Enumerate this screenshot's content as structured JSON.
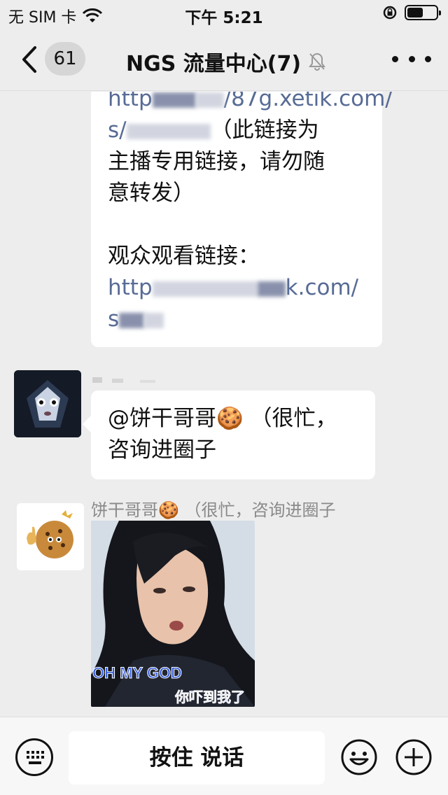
{
  "status_bar": {
    "carrier": "无 SIM 卡",
    "time": "下午 5:21",
    "battery_level": 0.55
  },
  "nav": {
    "unread_count": "61",
    "title": "NGS 流量中心(7)"
  },
  "messages": {
    "msg1": {
      "line1": "http",
      "line1_suffix": "/87g.xetik.com/",
      "line2_prefix": "s/",
      "line2_text": "（此链接为",
      "line3": "主播专用链接，请勿随",
      "line4": "意转发）",
      "line5": "观众观看链接：",
      "line6_prefix": "http",
      "line6_suffix": "k.com/",
      "line7": "s"
    },
    "msg2": {
      "text_line1": "@饼干哥哥🍪 （很忙，",
      "text_line2": "咨询进圈子"
    },
    "msg3": {
      "sender_name": "饼干哥哥🍪 （很忙，咨询进圈子",
      "sticker_caption_1": "OH MY GOD",
      "sticker_caption_2": "你吓到我了"
    }
  },
  "input_bar": {
    "hold_to_talk": "按住 说话"
  },
  "colors": {
    "background": "#ededed",
    "bubble": "#ffffff",
    "link": "#576b95"
  }
}
